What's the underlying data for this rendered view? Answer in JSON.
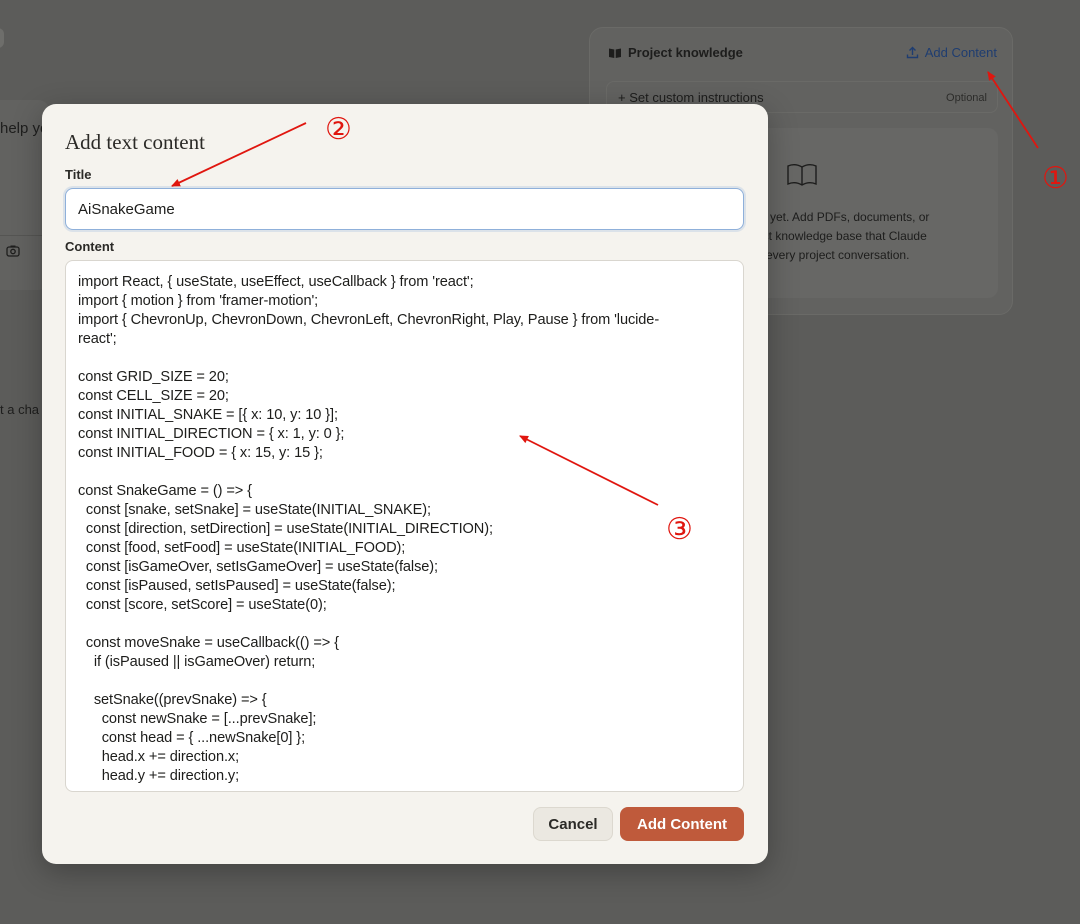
{
  "background": {
    "partial_text_1": "help yo",
    "partial_text_2": "t a cha",
    "camera_icon": "camera-icon",
    "knowledge_panel": {
      "icon": "book-icon",
      "title": "Project knowledge",
      "add_content_label": "Add Content",
      "add_content_icon": "upload-icon",
      "instructions_label": "+ Set custom instructions",
      "instructions_optional": "Optional",
      "empty_lines": [
        "d yet. Add PDFs, documents, or",
        "ect knowledge base that Claude",
        "every project conversation."
      ]
    }
  },
  "modal": {
    "title": "Add text content",
    "title_label": "Title",
    "title_value": "AiSnakeGame",
    "content_label": "Content",
    "content_value": "import React, { useState, useEffect, useCallback } from 'react';\nimport { motion } from 'framer-motion';\nimport { ChevronUp, ChevronDown, ChevronLeft, ChevronRight, Play, Pause } from 'lucide-\nreact';\n\nconst GRID_SIZE = 20;\nconst CELL_SIZE = 20;\nconst INITIAL_SNAKE = [{ x: 10, y: 10 }];\nconst INITIAL_DIRECTION = { x: 1, y: 0 };\nconst INITIAL_FOOD = { x: 15, y: 15 };\n\nconst SnakeGame = () => {\n  const [snake, setSnake] = useState(INITIAL_SNAKE);\n  const [direction, setDirection] = useState(INITIAL_DIRECTION);\n  const [food, setFood] = useState(INITIAL_FOOD);\n  const [isGameOver, setIsGameOver] = useState(false);\n  const [isPaused, setIsPaused] = useState(false);\n  const [score, setScore] = useState(0);\n\n  const moveSnake = useCallback(() => {\n    if (isPaused || isGameOver) return;\n\n    setSnake((prevSnake) => {\n      const newSnake = [...prevSnake];\n      const head = { ...newSnake[0] };\n      head.x += direction.x;\n      head.y += direction.y;",
    "cancel_label": "Cancel",
    "add_label": "Add Content"
  },
  "annotations": {
    "marker_1": "①",
    "marker_2": "②",
    "marker_3": "③",
    "color": "#e0160f"
  }
}
